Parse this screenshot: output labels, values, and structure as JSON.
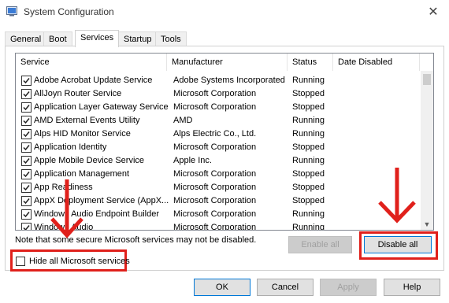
{
  "window": {
    "title": "System Configuration",
    "close_glyph": "✕"
  },
  "tabs": [
    {
      "label": "General",
      "active": false
    },
    {
      "label": "Boot",
      "active": false
    },
    {
      "label": "Services",
      "active": true
    },
    {
      "label": "Startup",
      "active": false
    },
    {
      "label": "Tools",
      "active": false
    }
  ],
  "services": {
    "columns": [
      "Service",
      "Manufacturer",
      "Status",
      "Date Disabled"
    ],
    "rows": [
      {
        "checked": true,
        "service": "Adobe Acrobat Update Service",
        "manufacturer": "Adobe Systems Incorporated",
        "status": "Running"
      },
      {
        "checked": true,
        "service": "AllJoyn Router Service",
        "manufacturer": "Microsoft Corporation",
        "status": "Stopped"
      },
      {
        "checked": true,
        "service": "Application Layer Gateway Service",
        "manufacturer": "Microsoft Corporation",
        "status": "Stopped"
      },
      {
        "checked": true,
        "service": "AMD External Events Utility",
        "manufacturer": "AMD",
        "status": "Running"
      },
      {
        "checked": true,
        "service": "Alps HID Monitor Service",
        "manufacturer": "Alps Electric Co., Ltd.",
        "status": "Running"
      },
      {
        "checked": true,
        "service": "Application Identity",
        "manufacturer": "Microsoft Corporation",
        "status": "Stopped"
      },
      {
        "checked": true,
        "service": "Apple Mobile Device Service",
        "manufacturer": "Apple Inc.",
        "status": "Running"
      },
      {
        "checked": true,
        "service": "Application Management",
        "manufacturer": "Microsoft Corporation",
        "status": "Stopped"
      },
      {
        "checked": true,
        "service": "App Readiness",
        "manufacturer": "Microsoft Corporation",
        "status": "Stopped"
      },
      {
        "checked": true,
        "service": "AppX Deployment Service (AppX...",
        "manufacturer": "Microsoft Corporation",
        "status": "Stopped"
      },
      {
        "checked": true,
        "service": "Windows Audio Endpoint Builder",
        "manufacturer": "Microsoft Corporation",
        "status": "Running"
      },
      {
        "checked": true,
        "service": "Windows Audio",
        "manufacturer": "Microsoft Corporation",
        "status": "Running"
      }
    ]
  },
  "note": "Note that some secure Microsoft services may not be disabled.",
  "hide_microsoft": {
    "label": "Hide all Microsoft services",
    "checked": false
  },
  "buttons": {
    "enable_all": "Enable all",
    "disable_all": "Disable all",
    "ok": "OK",
    "cancel": "Cancel",
    "apply": "Apply",
    "help": "Help"
  },
  "annotation_color": "#e0201b"
}
